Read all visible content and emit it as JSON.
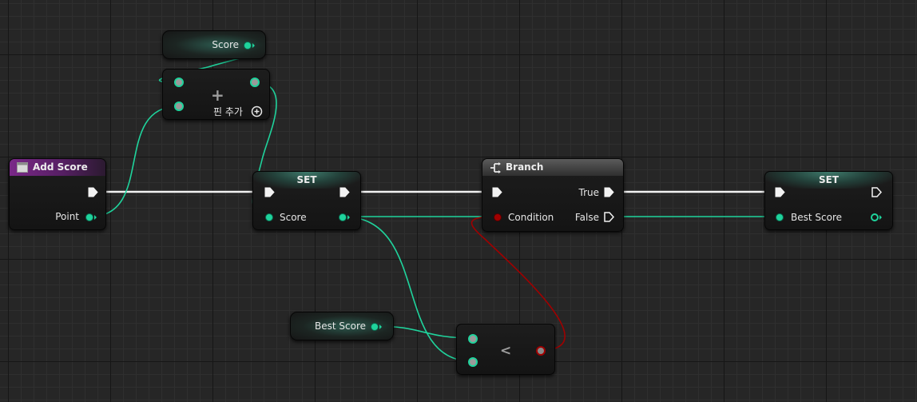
{
  "colors": {
    "background": "#262626",
    "exec_wire": "#f2f2f2",
    "data_wire_float": "#1fd39c",
    "bool_wire": "#a00000",
    "event_header": "#7a2888"
  },
  "nodes": {
    "score_getter": {
      "label": "Score"
    },
    "add": {
      "operator": "+",
      "add_pin_label": "핀 추가",
      "add_pin_icon": "plus-circle-icon"
    },
    "add_score_event": {
      "title": "Add Score",
      "icon": "event-icon",
      "output_label": "Point"
    },
    "set_score": {
      "title": "SET",
      "input_label": "Score"
    },
    "branch": {
      "title": "Branch",
      "icon": "branch-icon",
      "condition_label": "Condition",
      "true_label": "True",
      "false_label": "False"
    },
    "set_best_score": {
      "title": "SET",
      "input_label": "Best Score"
    },
    "best_score_getter": {
      "label": "Best Score"
    },
    "less": {
      "operator": "<"
    }
  }
}
